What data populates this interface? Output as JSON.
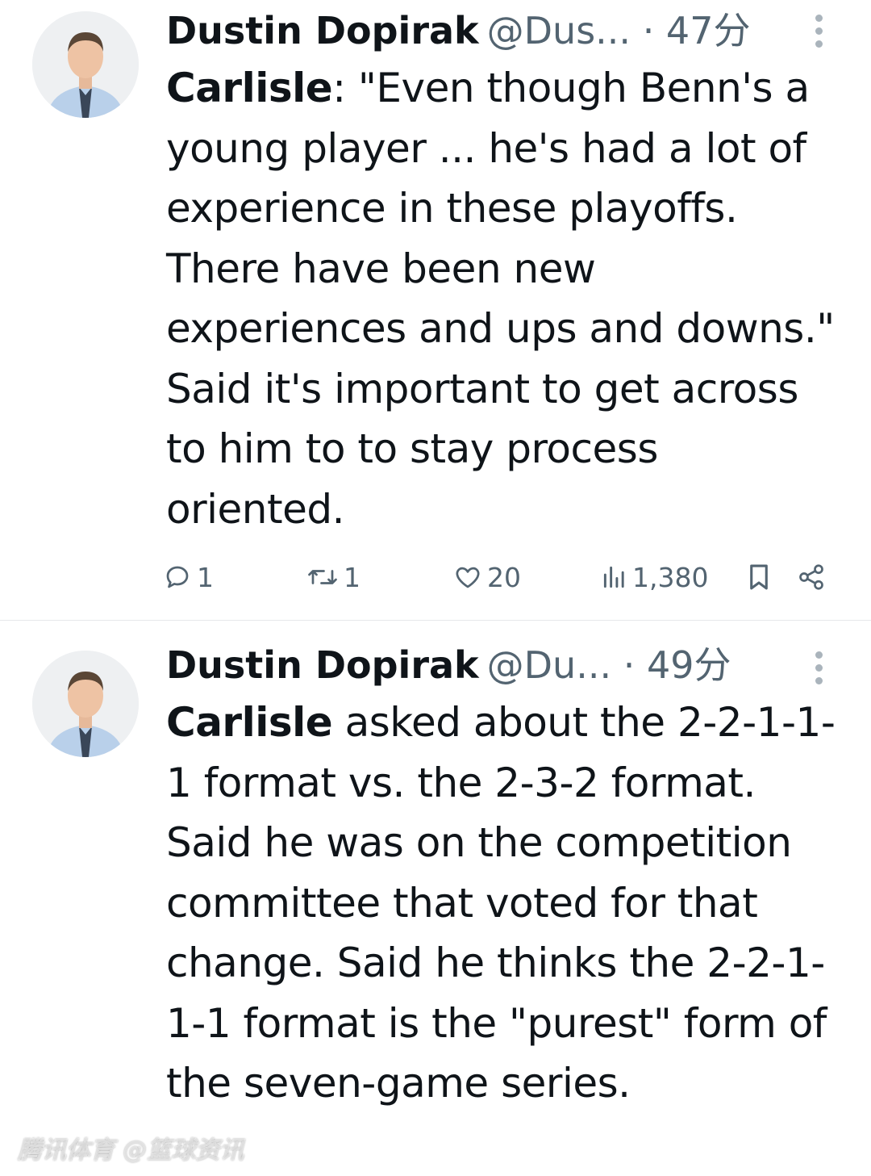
{
  "tweets": [
    {
      "display_name": "Dustin Dopirak",
      "handle": "@Dus...",
      "time": "· 47分",
      "body_bold": "Carlisle",
      "body_text": ": \"Even though Benn's a young player ... he's had a lot of experience in these playoffs. There have been new experiences and ups and downs.\" Said it's important to get across to him to to stay process oriented.",
      "actions": {
        "reply": "1",
        "retweet": "1",
        "like": "20",
        "views": "1,380"
      }
    },
    {
      "display_name": "Dustin Dopirak",
      "handle": "@Du...",
      "time": "· 49分",
      "body_bold": "Carlisle",
      "body_text": " asked about the 2-2-1-1-1 format vs. the 2-3-2 format. Said he was on the competition committee that voted for that change. Said he thinks the 2-2-1-1-1 format is the \"purest\" form of the seven-game series."
    }
  ],
  "watermark": "腾讯体育 @篮球资讯",
  "icons": {
    "reply": "reply-icon",
    "retweet": "retweet-icon",
    "like": "heart-icon",
    "views": "views-icon",
    "bookmark": "bookmark-icon",
    "share": "share-icon",
    "more": "more-options-icon"
  },
  "colors": {
    "text": "#0f1419",
    "secondary": "#536471",
    "divider": "#e6e8ea"
  }
}
